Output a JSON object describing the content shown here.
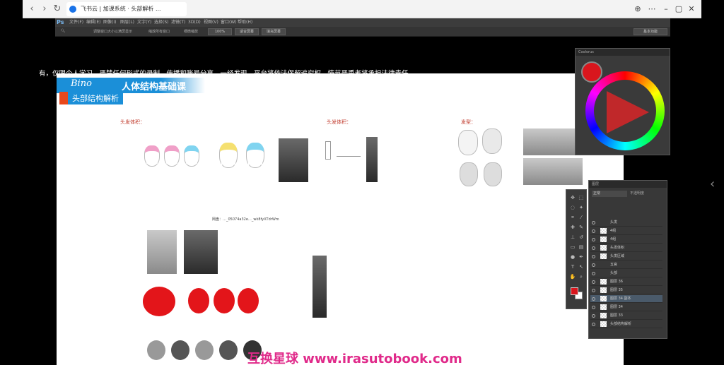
{
  "browser": {
    "tab_title": "飞书云 | 加课系统 · 头部解析 ...",
    "back_icon": "chevron-left-icon",
    "forward_icon": "chevron-right-icon",
    "refresh_icon": "refresh-icon"
  },
  "photoshop": {
    "logo": "Ps",
    "menus": [
      "文件(F)",
      "编辑(E)",
      "图像(I)",
      "图层(L)",
      "文字(Y)",
      "选择(S)",
      "滤镜(T)",
      "3D(D)",
      "视图(V)",
      "窗口(W)",
      "帮助(H)"
    ],
    "options": {
      "btn1": "调整窗口大小以满屏显示",
      "btn2": "缩放所有窗口",
      "btn3": "细微缩放",
      "btn4": "100%",
      "btn5": "适合屏幕",
      "btn6": "填充屏幕",
      "workspace": "基本功能"
    }
  },
  "document": {
    "copyright": "有，仅限个人学习，严禁任何形式的录制、传播和账号分享。一经发现，平台将依法保留追究权，情节严重者将承担法律责任。",
    "banner_logo": "Bino",
    "banner_title": "人体结构基础课",
    "sub_title": "头部结构解析",
    "labels": {
      "hair_volume": "头发体积：",
      "hair_form": "头发体积：",
      "hairstyle": "发型："
    },
    "caption": "网盘：…_05074a32e…_wk8fyXTdrWm"
  },
  "watermark": "互换星球 www.irasutobook.com",
  "color_panel": {
    "title": "Coolorus",
    "accent": "#d9161d"
  },
  "layers_panel": {
    "title": "图层",
    "mode": "正常",
    "opacity": "不透明度",
    "rows": [
      "头发",
      "4组",
      "4组",
      "头发体积",
      "头发区域",
      "五官",
      "头部",
      "图层 36",
      "图层 35",
      "图层 34 副本",
      "图层 34",
      "图层 33",
      "头部结构解析"
    ]
  },
  "tools_panel": {
    "fg_color": "#d9161d",
    "bg_color": "#ffffff"
  }
}
